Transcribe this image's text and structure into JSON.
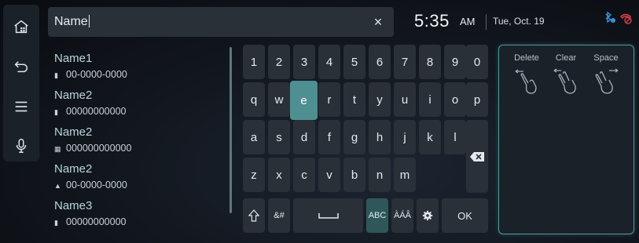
{
  "rail": {
    "items": [
      {
        "name": "home-icon"
      },
      {
        "name": "back-icon"
      },
      {
        "name": "menu-icon"
      },
      {
        "name": "microphone-icon"
      }
    ]
  },
  "search": {
    "value": "Name",
    "clear_symbol": "×"
  },
  "status": {
    "time": "5:35",
    "ampm": "AM",
    "date": "Tue, Oct. 19",
    "icons": [
      "bluetooth-phone-icon",
      "no-phone-icon"
    ],
    "accent": "#4e8f92"
  },
  "contacts": [
    {
      "name": "Name1",
      "number": "00-0000-0000",
      "type_icon": "mobile-phone-icon"
    },
    {
      "name": "Name2",
      "number": "00000000000",
      "type_icon": "mobile-phone-icon"
    },
    {
      "name": "Name2",
      "number": "000000000000",
      "type_icon": "office-icon"
    },
    {
      "name": "Name2",
      "number": "00-0000-0000",
      "type_icon": "home-phone-icon"
    },
    {
      "name": "Name3",
      "number": "00000000000",
      "type_icon": "mobile-phone-icon"
    }
  ],
  "keyboard": {
    "row1": [
      "1",
      "2",
      "3",
      "4",
      "5",
      "6",
      "7",
      "8",
      "9",
      "0"
    ],
    "row2": [
      "q",
      "w",
      "e",
      "r",
      "t",
      "y",
      "u",
      "i",
      "o",
      "p"
    ],
    "row3": [
      "a",
      "s",
      "d",
      "f",
      "g",
      "h",
      "j",
      "k",
      "l"
    ],
    "row4": [
      "z",
      "x",
      "c",
      "v",
      "b",
      "n",
      "m"
    ],
    "active_key": "e",
    "symbols_label": "&#",
    "abc_label": "ABC",
    "accents_label": "ÀÁÂ",
    "ok_label": "OK"
  },
  "gestures": [
    {
      "label": "Delete",
      "icon": "swipe-left-one-finger-icon"
    },
    {
      "label": "Clear",
      "icon": "swipe-left-two-fingers-icon"
    },
    {
      "label": "Space",
      "icon": "swipe-right-two-fingers-icon"
    }
  ]
}
